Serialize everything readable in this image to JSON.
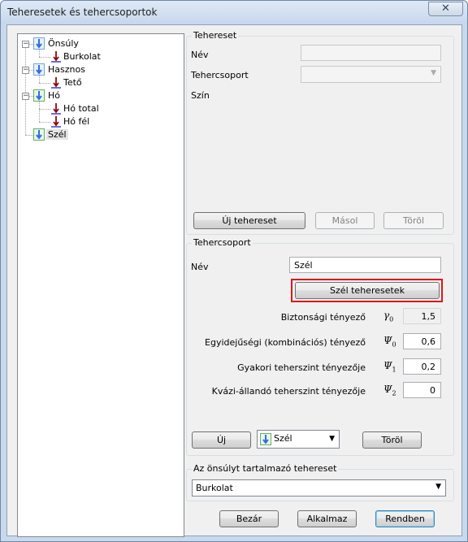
{
  "window": {
    "title": "Teheresetek és tehercsoportok",
    "close_glyph": "✕"
  },
  "tree": {
    "items": [
      {
        "label": "Önsúly",
        "level": 0,
        "expanded": true
      },
      {
        "label": "Burkolat",
        "level": 1
      },
      {
        "label": "Hasznos",
        "level": 0,
        "expanded": true
      },
      {
        "label": "Tető",
        "level": 1
      },
      {
        "label": "Hó",
        "level": 0,
        "expanded": true
      },
      {
        "label": "Hó total",
        "level": 1
      },
      {
        "label": "Hó fél",
        "level": 1
      },
      {
        "label": "Szél",
        "level": 0,
        "selected": true
      }
    ],
    "expander_glyph": "−"
  },
  "tehereset": {
    "title": "Tehereset",
    "nev_label": "Név",
    "nev_value": "",
    "tehercsoport_label": "Tehercsoport",
    "tehercsoport_value": "",
    "szin_label": "Szín",
    "buttons": {
      "new": "Új tehereset",
      "copy": "Másol",
      "delete": "Töröl"
    }
  },
  "tehercsoport": {
    "title": "Tehercsoport",
    "nev_label": "Név",
    "nev_value": "Szél",
    "szel_button": "Szél teheresetek",
    "factors": [
      {
        "label": "Biztonsági tényező",
        "symbol": "γ",
        "sub": "0",
        "value": "1,5",
        "readonly": true
      },
      {
        "label": "Egyidejűségi (kombinációs) tényező",
        "symbol": "Ψ",
        "sub": "0",
        "value": "0,6"
      },
      {
        "label": "Gyakori teherszint tényezője",
        "symbol": "Ψ",
        "sub": "1",
        "value": "0,2"
      },
      {
        "label": "Kvázi-állandó teherszint tényezője",
        "symbol": "Ψ",
        "sub": "2",
        "value": "0"
      }
    ],
    "new_button": "Új",
    "type_combo": "Szél",
    "delete_button": "Töröl"
  },
  "onsuly": {
    "title": "Az önsúlyt tartalmazó tehereset",
    "value": "Burkolat"
  },
  "footer": {
    "close": "Bezár",
    "apply": "Alkalmaz",
    "ok": "Rendben"
  },
  "colors": {
    "highlight_box": "#e0141c",
    "icon_blue": "#2f6fd8",
    "icon_green": "#2a9a2a",
    "icon_red": "#8a0a0a"
  }
}
